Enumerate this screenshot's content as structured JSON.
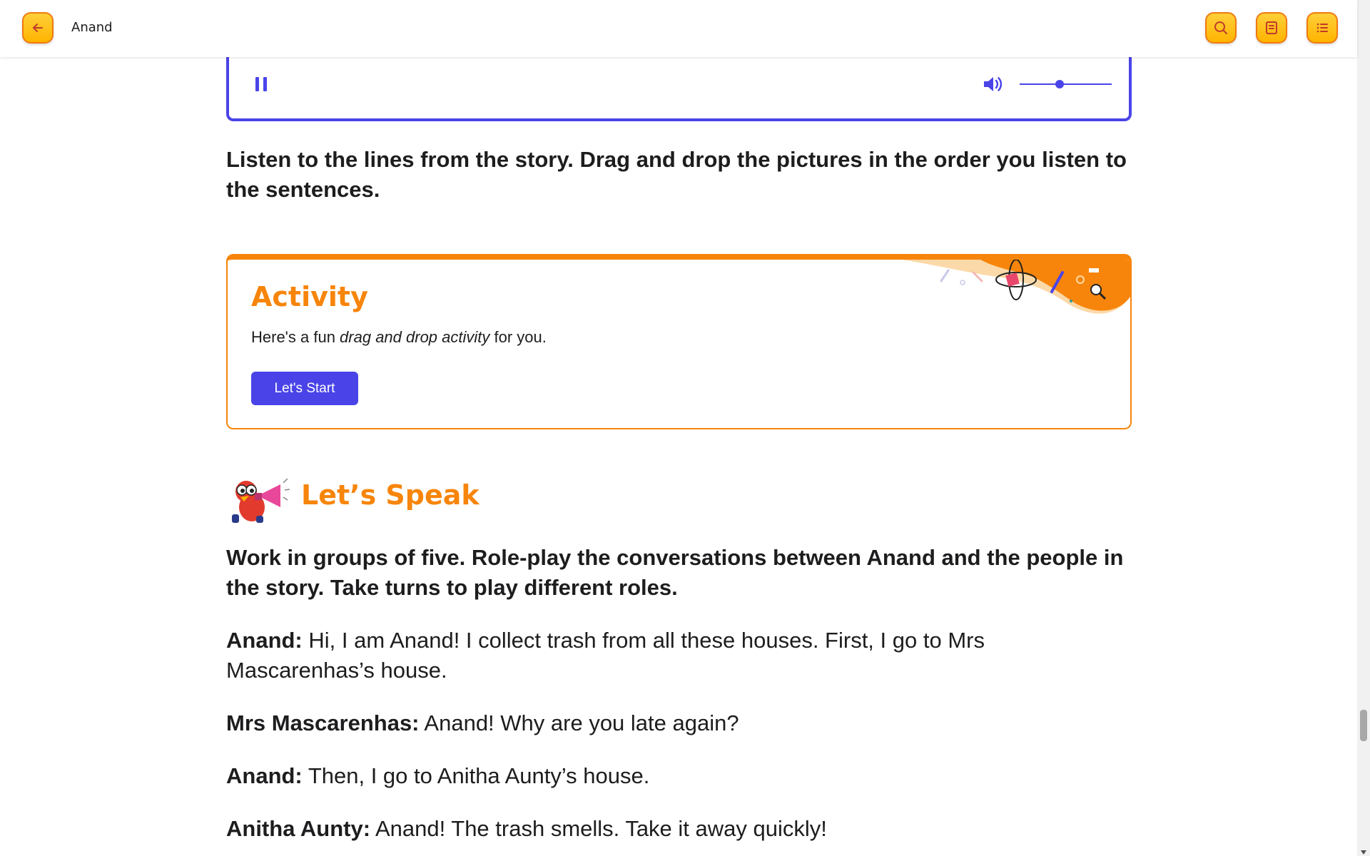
{
  "header": {
    "title": "Anand",
    "back_icon": "arrow-left-icon",
    "actions": [
      {
        "icon": "search-icon"
      },
      {
        "icon": "notes-icon"
      },
      {
        "icon": "list-icon"
      }
    ]
  },
  "audio": {
    "state": "playing",
    "volume_level": 0.4
  },
  "instruction_1": "Listen to the lines from the story. Drag and drop the pictures in the order you listen to the sentences.",
  "activity": {
    "title": "Activity",
    "desc_before": "Here's a fun ",
    "desc_emphasis": "drag and drop activity",
    "desc_after": " for you.",
    "button_label": "Let's Start"
  },
  "speak": {
    "title": "Let’s Speak",
    "instruction": "Work in groups of five. Role-play the conversations between Anand and the people in the story. Take turns to play different roles.",
    "lines": [
      {
        "speaker": "Anand:",
        "text": " Hi, I am Anand! I collect trash from all these houses. First, I go to Mrs Mascarenhas’s house."
      },
      {
        "speaker": "Mrs Mascarenhas:",
        "text": " Anand! Why are you late again?"
      },
      {
        "speaker": "Anand:",
        "text": " Then, I go to Anitha Aunty’s house."
      },
      {
        "speaker": "Anitha Aunty:",
        "text": " Anand! The trash smells. Take it away quickly!"
      }
    ]
  },
  "colors": {
    "accent_blue": "#4a44e8",
    "accent_orange": "#f7850b",
    "button_yellow": "#ffc21a"
  }
}
